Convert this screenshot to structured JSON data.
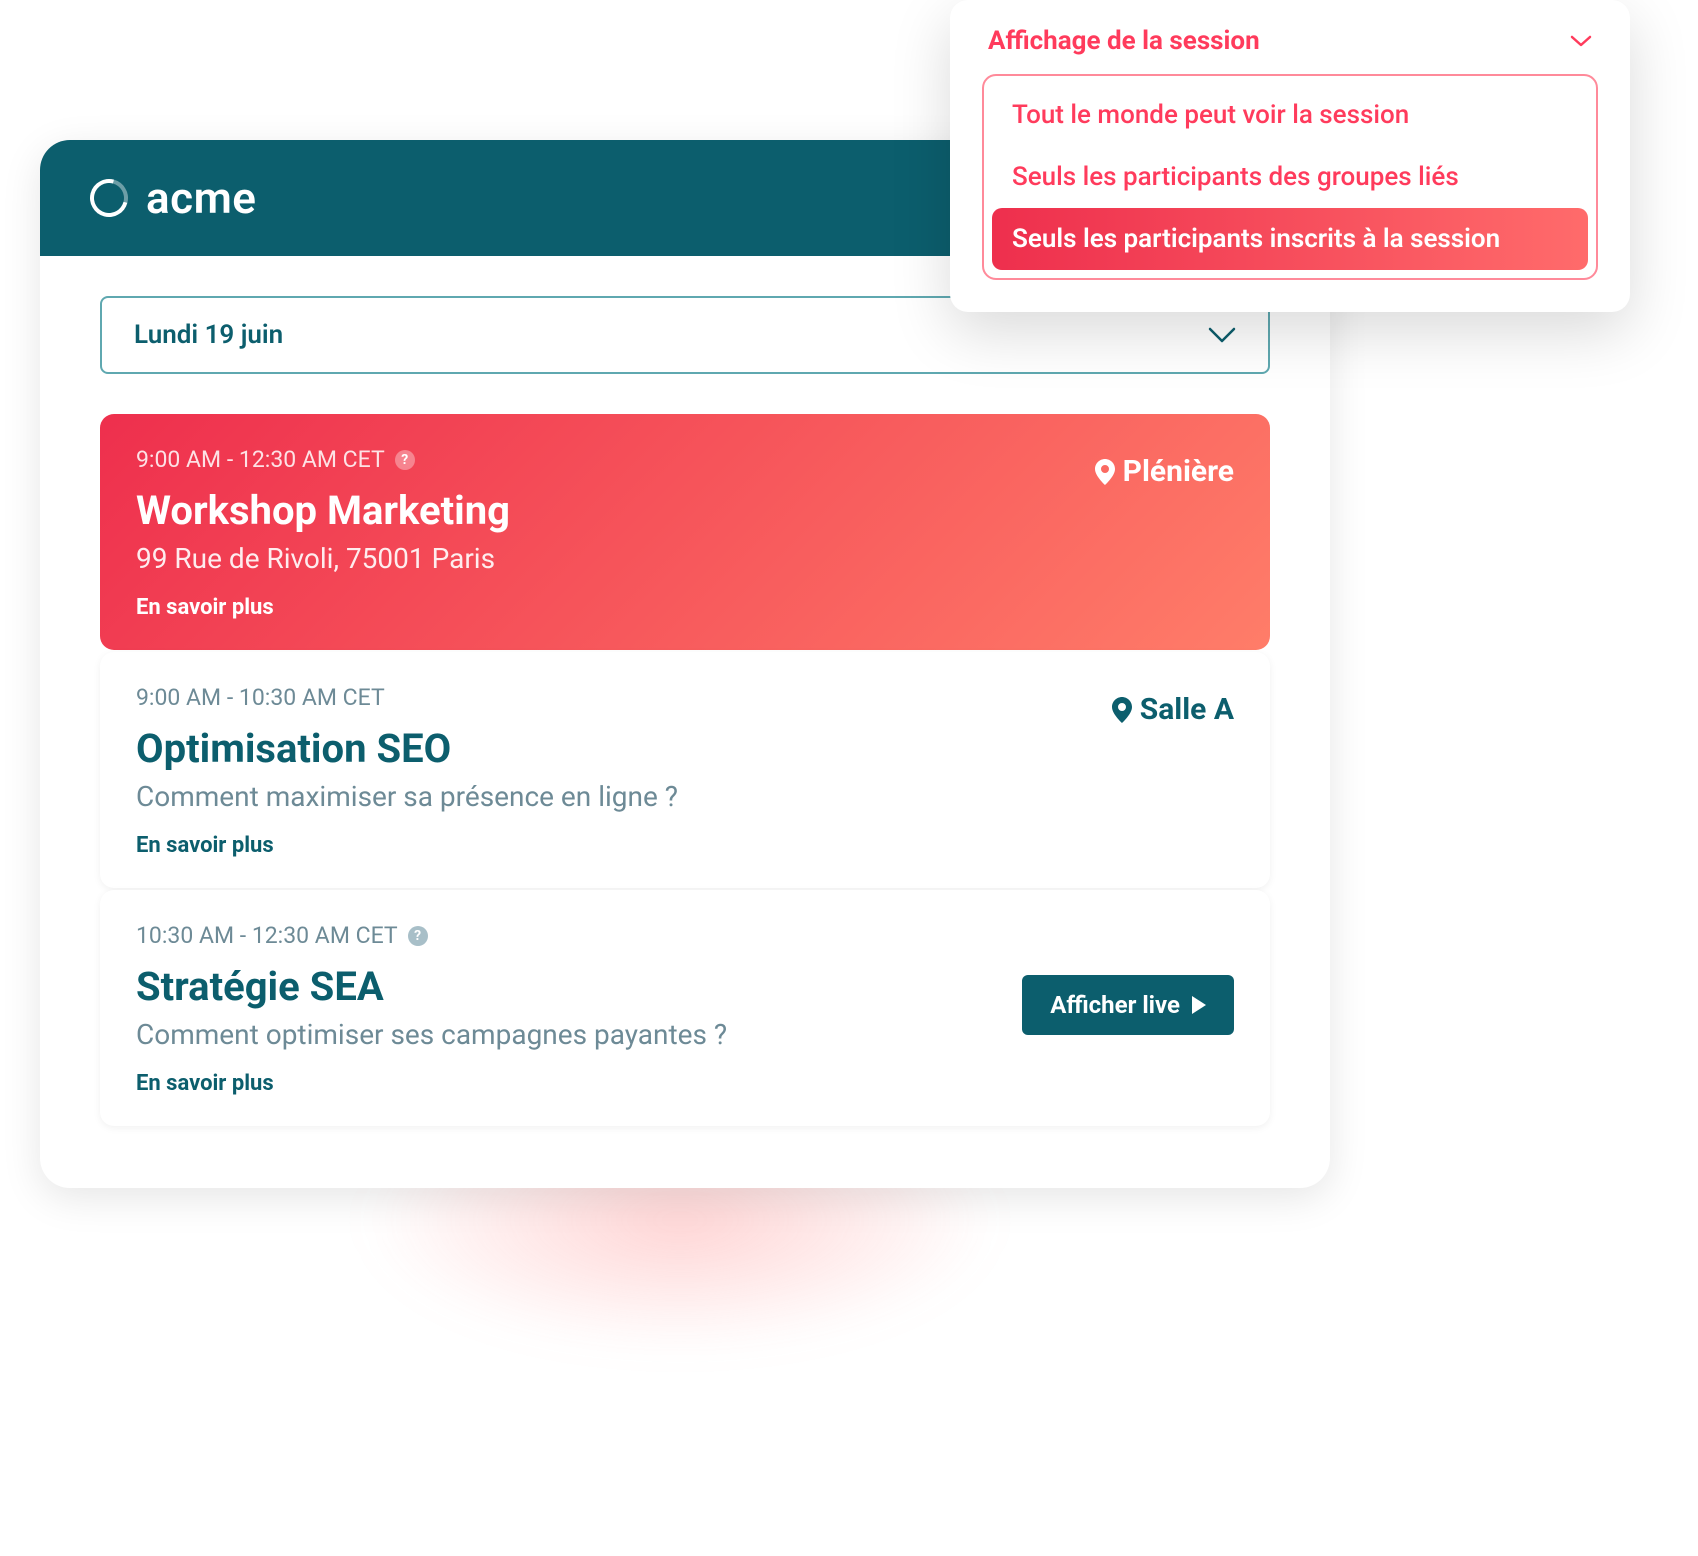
{
  "brand": {
    "name": "acme"
  },
  "dateSelector": {
    "selected": "Lundi 19 juin"
  },
  "sessions": [
    {
      "time": "9:00 AM - 12:30 AM CET",
      "hasHelp": true,
      "title": "Workshop Marketing",
      "subtitle": "99 Rue de Rivoli, 75001  Paris",
      "more": "En savoir plus",
      "location": "Plénière",
      "featured": true
    },
    {
      "time": "9:00 AM - 10:30 AM CET",
      "hasHelp": false,
      "title": "Optimisation SEO",
      "subtitle": "Comment maximiser sa présence en ligne ?",
      "more": "En savoir plus",
      "location": "Salle A",
      "featured": false
    },
    {
      "time": "10:30 AM - 12:30 AM CET",
      "hasHelp": true,
      "title": "Stratégie SEA",
      "subtitle": "Comment optimiser ses campagnes payantes ?",
      "more": "En savoir plus",
      "liveButton": "Afficher live",
      "featured": false
    }
  ],
  "dropdown": {
    "title": "Affichage de la session",
    "options": [
      {
        "label": "Tout le monde peut voir la session",
        "selected": false
      },
      {
        "label": "Seuls les participants des groupes liés",
        "selected": false
      },
      {
        "label": "Seuls les participants inscrits à la session",
        "selected": true
      }
    ]
  }
}
